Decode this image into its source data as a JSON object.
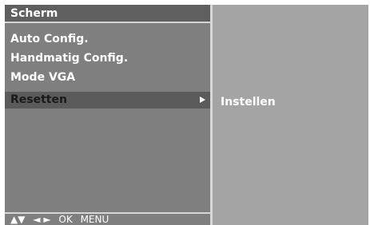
{
  "menu": {
    "title": "Scherm",
    "items": [
      {
        "label": "Auto Config."
      },
      {
        "label": "Handmatig Config."
      },
      {
        "label": "Mode VGA"
      },
      {
        "label": "Resetten",
        "selected": true
      }
    ]
  },
  "submenu": {
    "items": [
      {
        "label": "Instellen"
      }
    ]
  },
  "footer": {
    "updown": "▲▼",
    "leftright": "◄ ►",
    "ok": "OK",
    "menu": "MENU"
  },
  "colors": {
    "panel_bg": "#7f7f7f",
    "title_bg": "#5f5f5f",
    "selected_bg": "#5b5b5b",
    "submenu_bg": "#a4a4a4",
    "divider": "#d6d6d6"
  }
}
